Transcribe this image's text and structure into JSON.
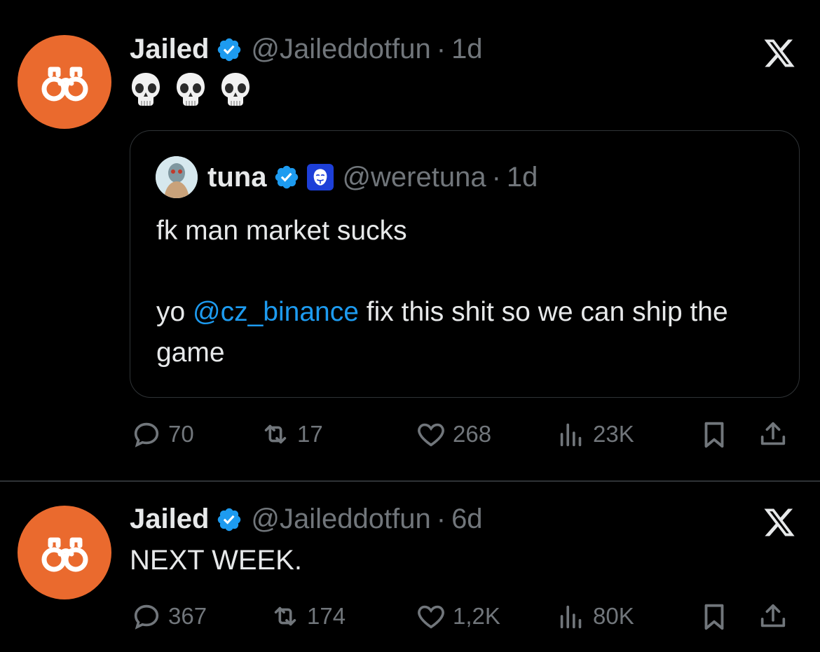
{
  "tweets": [
    {
      "name": "Jailed",
      "handle": "@Jaileddotfun",
      "separator": "·",
      "time": "1d",
      "text": "💀💀💀",
      "quote": {
        "name": "tuna",
        "handle": "@weretuna",
        "time": "1d",
        "line1": "fk man market sucks",
        "pre_mention": "yo ",
        "mention": "@cz_binance",
        "post_mention": " fix this shit so we can ship the game"
      },
      "stats": {
        "replies": "70",
        "reposts": "17",
        "likes": "268",
        "views": "23K"
      }
    },
    {
      "name": "Jailed",
      "handle": "@Jaileddotfun",
      "separator": "·",
      "time": "6d",
      "text": "NEXT WEEK.",
      "stats": {
        "replies": "367",
        "reposts": "174",
        "likes": "1,2K",
        "views": "80K"
      }
    }
  ],
  "colors": {
    "background": "#000000",
    "accent": "#1d9bf0",
    "avatar": "#ea6a2e",
    "muted": "#71767b"
  }
}
